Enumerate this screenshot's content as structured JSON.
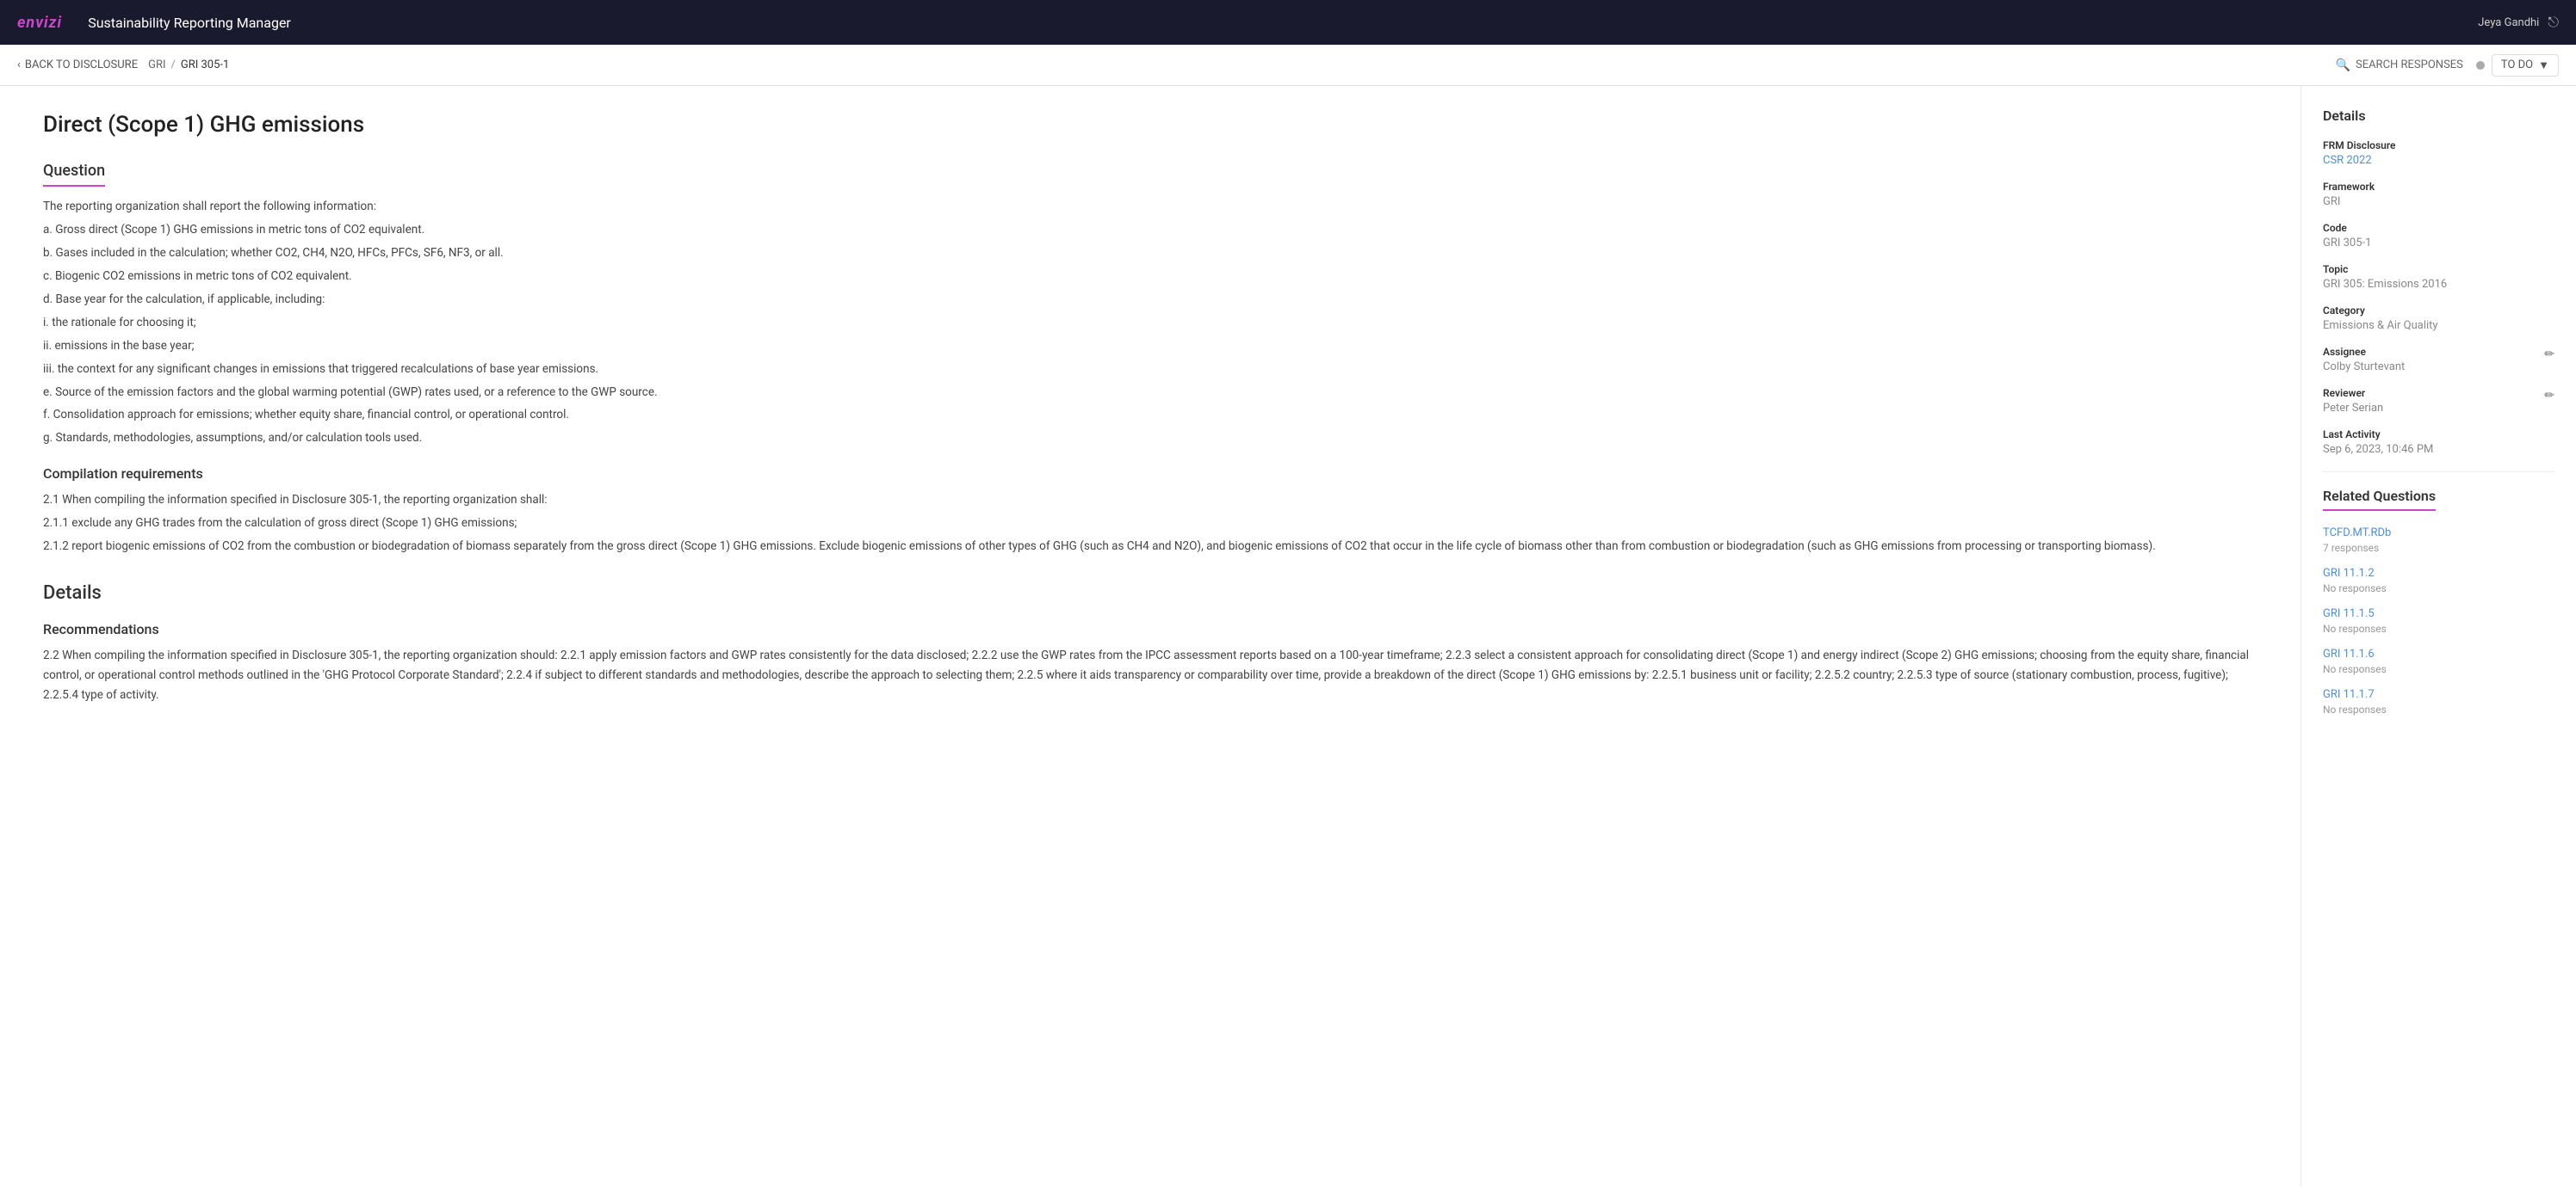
{
  "app": {
    "logo": "envizi",
    "title": "Sustainability Reporting Manager"
  },
  "user": {
    "name": "Jeya Gandhi"
  },
  "breadcrumb": {
    "back_label": "BACK TO DISCLOSURE",
    "sep1": "GRI",
    "sep2": "/",
    "current": "GRI 305-1"
  },
  "toolbar": {
    "search_label": "SEARCH RESPONSES",
    "todo_label": "TO DO"
  },
  "main": {
    "page_title": "Direct (Scope 1) GHG emissions",
    "question_section": "Question",
    "question_intro": "The reporting organization shall report the following information:",
    "question_items": [
      "a. Gross direct (Scope 1) GHG emissions in metric tons of CO2 equivalent.",
      "b. Gases included in the calculation; whether CO2, CH4, N2O, HFCs, PFCs, SF6, NF3, or all.",
      "c. Biogenic CO2 emissions in metric tons of CO2 equivalent.",
      "d. Base year for the calculation, if applicable, including:",
      "i. the rationale for choosing it;",
      "ii. emissions in the base year;",
      "iii. the context for any significant changes in emissions that triggered recalculations of base year emissions.",
      "e. Source of the emission factors and the global warming potential (GWP) rates used, or a reference to the GWP source.",
      "f. Consolidation approach for emissions; whether equity share, financial control, or operational control.",
      "g. Standards, methodologies, assumptions, and/or calculation tools used."
    ],
    "compilation_heading": "Compilation requirements",
    "compilation_items": [
      "2.1 When compiling the information specified in Disclosure 305-1, the reporting organization shall:",
      "2.1.1 exclude any GHG trades from the calculation of gross direct (Scope 1) GHG emissions;",
      "2.1.2 report biogenic emissions of CO2 from the combustion or biodegradation of biomass separately from the gross direct (Scope 1) GHG emissions. Exclude biogenic emissions of other types of GHG (such as CH4 and N2O), and biogenic emissions of CO2 that occur in the life cycle of biomass other than from combustion or biodegradation (such as GHG emissions from processing or transporting biomass)."
    ],
    "details_heading": "Details",
    "recommendations_heading": "Recommendations",
    "recommendations_text": "2.2 When compiling the information specified in Disclosure 305-1, the reporting organization should: 2.2.1 apply emission factors and GWP rates consistently for the data disclosed; 2.2.2 use the GWP rates from the IPCC assessment reports based on a 100-year timeframe; 2.2.3 select a consistent approach for consolidating direct (Scope 1) and energy indirect (Scope 2) GHG emissions; choosing from the equity share, financial control, or operational control methods outlined in the 'GHG Protocol Corporate Standard'; 2.2.4 if subject to different standards and methodologies, describe the approach to selecting them; 2.2.5 where it aids transparency or comparability over time, provide a breakdown of the direct (Scope 1) GHG emissions by: 2.2.5.1 business unit or facility; 2.2.5.2 country; 2.2.5.3 type of source (stationary combustion, process, fugitive); 2.2.5.4 type of activity."
  },
  "sidebar": {
    "details_title": "Details",
    "frm_label": "FRM Disclosure",
    "frm_value": "CSR 2022",
    "framework_label": "Framework",
    "framework_value": "GRI",
    "code_label": "Code",
    "code_value": "GRI 305-1",
    "topic_label": "Topic",
    "topic_value": "GRI 305: Emissions 2016",
    "category_label": "Category",
    "category_value": "Emissions & Air Quality",
    "assignee_label": "Assignee",
    "assignee_value": "Colby Sturtevant",
    "reviewer_label": "Reviewer",
    "reviewer_value": "Peter Serian",
    "last_activity_label": "Last Activity",
    "last_activity_value": "Sep 6, 2023, 10:46 PM",
    "related_title": "Related Questions",
    "related_items": [
      {
        "code": "TCFD.MT.RDb",
        "responses": "7 responses"
      },
      {
        "code": "GRI 11.1.2",
        "responses": "No responses"
      },
      {
        "code": "GRI 11.1.5",
        "responses": "No responses"
      },
      {
        "code": "GRI 11.1.6",
        "responses": "No responses"
      },
      {
        "code": "GRI 11.1.7",
        "responses": "No responses"
      }
    ]
  }
}
